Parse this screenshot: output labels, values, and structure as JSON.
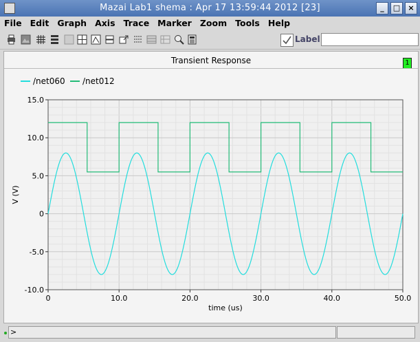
{
  "window": {
    "title": "Mazai Lab1 shema : Apr 17 13:59:44 2012 [23]"
  },
  "menu": [
    "File",
    "Edit",
    "Graph",
    "Axis",
    "Trace",
    "Marker",
    "Zoom",
    "Tools",
    "Help"
  ],
  "toolbar": {
    "label_text": "Label",
    "label_value": ""
  },
  "graph": {
    "title": "Transient Response",
    "number": "1"
  },
  "status": {
    "prompt": ">"
  },
  "colors": {
    "net060": "#22dddd",
    "net012": "#22bb77"
  },
  "chart_data": {
    "type": "line",
    "title": "Transient Response",
    "xlabel": "time (us)",
    "ylabel": "V (V)",
    "xlim": [
      0,
      50
    ],
    "ylim": [
      -10,
      15
    ],
    "xticks": [
      0,
      10,
      20,
      30,
      40,
      50
    ],
    "xtick_labels": [
      "0",
      "10.0",
      "20.0",
      "30.0",
      "40.0",
      "50.0"
    ],
    "yticks": [
      -10,
      -5,
      0,
      5,
      10,
      15
    ],
    "ytick_labels": [
      "-10.0",
      "-5.0",
      "0",
      "5.0",
      "10.0",
      "15.0"
    ],
    "grid": true,
    "legend_position": "top-left",
    "series": [
      {
        "name": "/net060",
        "color": "#22dddd",
        "x": [
          0,
          1,
          2,
          2.5,
          3,
          4,
          5,
          6,
          7,
          7.5,
          8,
          9,
          10,
          11,
          12,
          12.5,
          13,
          14,
          15,
          16,
          17,
          17.5,
          18,
          19,
          20,
          21,
          22,
          22.5,
          23,
          24,
          25,
          26,
          27,
          27.5,
          28,
          29,
          30,
          31,
          32,
          32.5,
          33,
          34,
          35,
          36,
          37,
          37.5,
          38,
          39,
          40,
          41,
          42,
          42.5,
          43,
          44,
          45,
          46,
          47,
          47.5,
          48,
          49,
          50
        ],
        "y": [
          0,
          4.7,
          7.6,
          8,
          7.6,
          4.7,
          0,
          -4.7,
          -7.6,
          -8,
          -7.6,
          -4.7,
          0,
          4.7,
          7.6,
          8,
          7.6,
          4.7,
          0,
          -4.7,
          -7.6,
          -8,
          -7.6,
          -4.7,
          0,
          4.7,
          7.6,
          8,
          7.6,
          4.7,
          0,
          -4.7,
          -7.6,
          -8,
          -7.6,
          -4.7,
          0,
          4.7,
          7.6,
          8,
          7.6,
          4.7,
          0,
          -4.7,
          -7.6,
          -8,
          -7.6,
          -4.7,
          0,
          4.7,
          7.6,
          8,
          7.6,
          4.7,
          0,
          -4.7,
          -7.6,
          -8,
          -7.6,
          -4.7,
          0
        ]
      },
      {
        "name": "/net012",
        "color": "#22bb77",
        "x": [
          0,
          5.5,
          5.5,
          10,
          10,
          15.5,
          15.5,
          20,
          20,
          25.5,
          25.5,
          30,
          30,
          35.5,
          35.5,
          40,
          40,
          45.5,
          45.5,
          50
        ],
        "y": [
          12,
          12,
          5.5,
          5.5,
          12,
          12,
          5.5,
          5.5,
          12,
          12,
          5.5,
          5.5,
          12,
          12,
          5.5,
          5.5,
          12,
          12,
          5.5,
          5.5
        ]
      }
    ]
  }
}
